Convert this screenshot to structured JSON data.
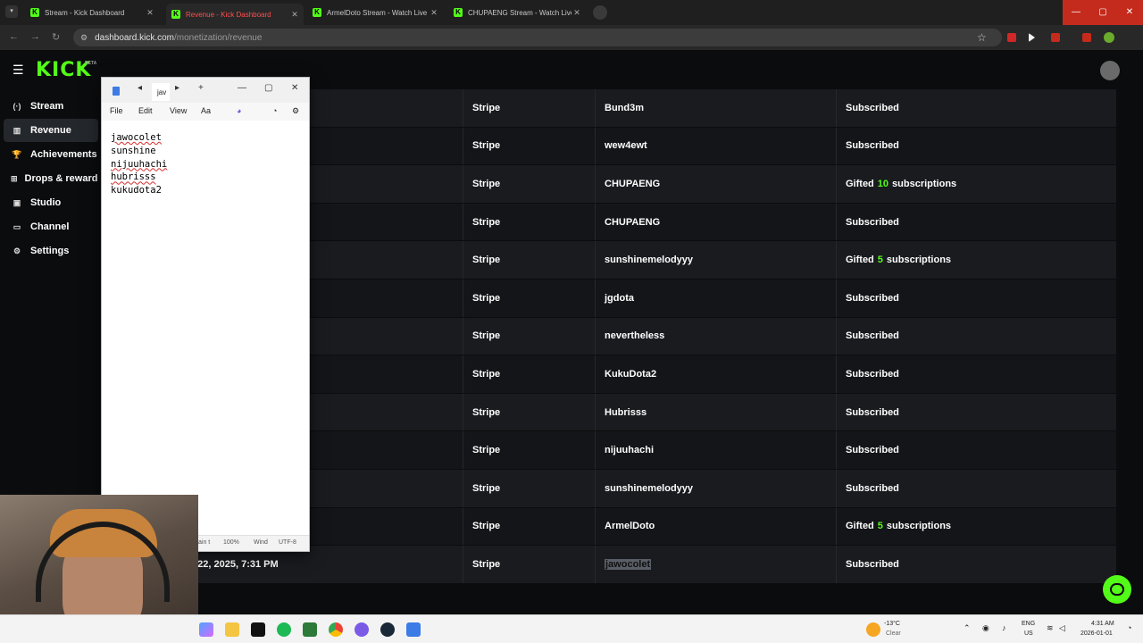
{
  "browser": {
    "tabs": [
      {
        "label": "Stream - Kick Dashboard",
        "active": false
      },
      {
        "label": "Revenue - Kick Dashboard",
        "active": true
      },
      {
        "label": "ArmelDoto Stream - Watch Live",
        "active": false
      },
      {
        "label": "CHUPAENG Stream - Watch Live",
        "active": false
      }
    ],
    "url_domain": "dashboard.kick.com",
    "url_path": "/monetization/revenue"
  },
  "app": {
    "logo": "KICK",
    "beta": "BETA",
    "sidebar": [
      {
        "label": "Stream",
        "icon": "broadcast-icon",
        "glyph": "(·)",
        "active": false
      },
      {
        "label": "Revenue",
        "icon": "revenue-icon",
        "glyph": "▥",
        "active": true
      },
      {
        "label": "Achievements",
        "icon": "trophy-icon",
        "glyph": "🏆",
        "active": false
      },
      {
        "label": "Drops & rewards",
        "icon": "gift-icon",
        "glyph": "⊞",
        "active": false
      },
      {
        "label": "Studio",
        "icon": "studio-icon",
        "glyph": "▣",
        "active": false
      },
      {
        "label": "Channel",
        "icon": "channel-icon",
        "glyph": "▭",
        "active": false
      },
      {
        "label": "Settings",
        "icon": "gear-icon",
        "glyph": "⚙",
        "active": false
      }
    ],
    "rows": [
      {
        "date": "",
        "method": "Stripe",
        "user": "Bund3m",
        "type_pre": "Subscribed",
        "count": "",
        "type_post": ""
      },
      {
        "date": "",
        "method": "Stripe",
        "user": "wew4ewt",
        "type_pre": "Subscribed",
        "count": "",
        "type_post": ""
      },
      {
        "date": "",
        "method": "Stripe",
        "user": "CHUPAENG",
        "type_pre": "Gifted",
        "count": "10",
        "type_post": "subscriptions"
      },
      {
        "date": "",
        "method": "Stripe",
        "user": "CHUPAENG",
        "type_pre": "Subscribed",
        "count": "",
        "type_post": ""
      },
      {
        "date": "",
        "method": "Stripe",
        "user": "sunshinemelodyyy",
        "type_pre": "Gifted",
        "count": "5",
        "type_post": "subscriptions"
      },
      {
        "date": "",
        "method": "Stripe",
        "user": "jgdota",
        "type_pre": "Subscribed",
        "count": "",
        "type_post": ""
      },
      {
        "date": "",
        "method": "Stripe",
        "user": "nevertheless",
        "type_pre": "Subscribed",
        "count": "",
        "type_post": ""
      },
      {
        "date": "",
        "method": "Stripe",
        "user": "KukuDota2",
        "type_pre": "Subscribed",
        "count": "",
        "type_post": ""
      },
      {
        "date": "",
        "method": "Stripe",
        "user": "Hubrisss",
        "type_pre": "Subscribed",
        "count": "",
        "type_post": ""
      },
      {
        "date": "",
        "method": "Stripe",
        "user": "nijuuhachi",
        "type_pre": "Subscribed",
        "count": "",
        "type_post": ""
      },
      {
        "date": "",
        "method": "Stripe",
        "user": "sunshinemelodyyy",
        "type_pre": "Subscribed",
        "count": "",
        "type_post": ""
      },
      {
        "date": "",
        "method": "Stripe",
        "user": "ArmelDoto",
        "type_pre": "Gifted",
        "count": "5",
        "type_post": "subscriptions"
      },
      {
        "date": "c 22, 2025, 7:31 PM",
        "method": "Stripe",
        "user": "jawocolet",
        "type_pre": "Subscribed",
        "count": "",
        "type_post": "",
        "highlight": true
      }
    ]
  },
  "notepad": {
    "tab_label": "jav",
    "menu": {
      "file": "File",
      "edit": "Edit",
      "view": "View"
    },
    "lines": [
      "jawocolet",
      "sunshine",
      "nijuuhachi",
      "hubrisss",
      "kukudota2"
    ],
    "status": {
      "lang": "ain t",
      "zoom": "100%",
      "eol": "Wind",
      "encoding": "UTF-8"
    }
  },
  "taskbar": {
    "weather_temp": "-13°C",
    "weather_desc": "Clear",
    "lang": "ENG",
    "region": "US",
    "time": "4:31 AM",
    "date": "2026-01-01"
  },
  "colors": {
    "accent": "#53fc18",
    "row_odd": "#191b1f",
    "row_even": "#141518",
    "win_close": "#c42b1c"
  }
}
